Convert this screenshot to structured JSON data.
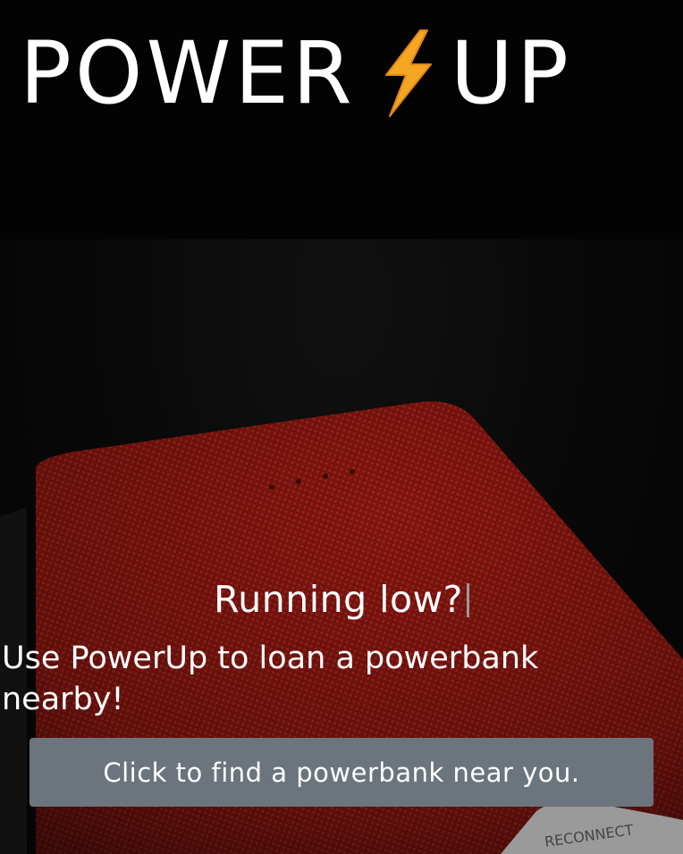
{
  "header": {
    "logo_left": "POWER",
    "logo_icon": "lightning-bolt-icon",
    "logo_right": "UP"
  },
  "hero": {
    "headline": "Running low?",
    "subline": "Use PowerUp to loan a powerbank nearby!",
    "cta_label": "Click to find a powerbank near you.",
    "device_brand": "RECONNECT"
  },
  "colors": {
    "header_bg": "#030303",
    "powerbank": "#8a1812",
    "bolt": "#f5a623",
    "cta_bg": "#6c757d"
  }
}
